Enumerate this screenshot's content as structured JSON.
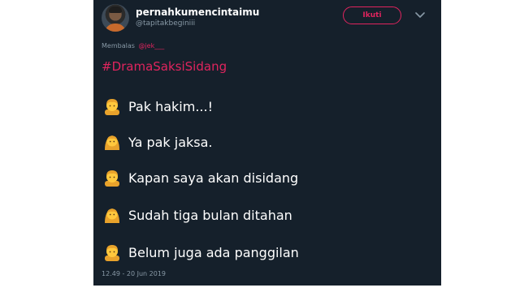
{
  "tweet": {
    "display_name": "pernahkumencintaimu",
    "handle": "@tapitakbeginiii",
    "follow_label": "Ikuti",
    "replying_to_prefix": "Membalas",
    "replying_to_mention": "@jek___",
    "hashtag": "#DramaSaksiSidang",
    "lines": [
      {
        "emoji": "man-icon",
        "text": "Pak hakim...!"
      },
      {
        "emoji": "woman-icon",
        "text": "Ya pak jaksa."
      },
      {
        "emoji": "man-icon",
        "text": "Kapan saya akan disidang"
      },
      {
        "emoji": "woman-icon",
        "text": "Sudah tiga bulan ditahan"
      },
      {
        "emoji": "man-icon",
        "text": "Belum juga ada panggilan"
      }
    ],
    "timestamp": "12.49 - 20 Jun 2019"
  },
  "colors": {
    "background": "#15202b",
    "accent": "#e0245e",
    "secondary_text": "#8899a6",
    "emoji_yellow": "#ffc83d"
  }
}
